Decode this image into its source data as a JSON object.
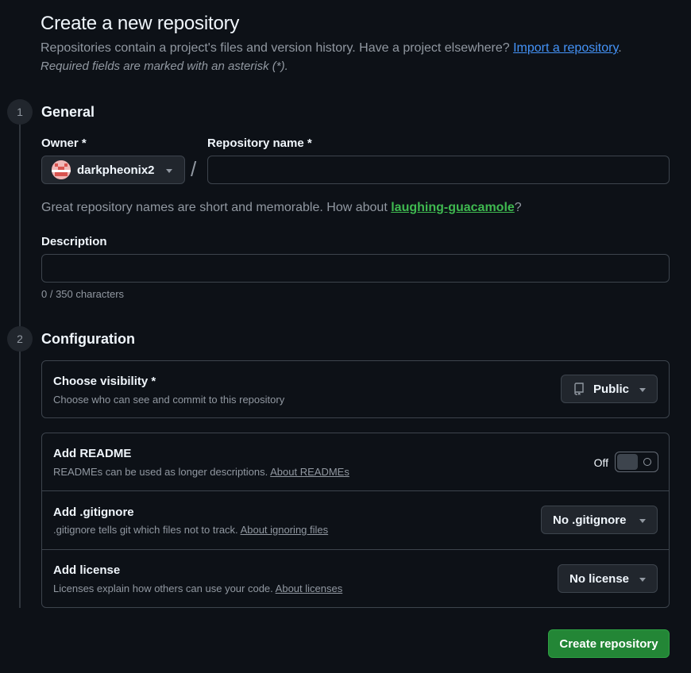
{
  "header": {
    "title": "Create a new repository",
    "subtitle_text": "Repositories contain a project's files and version history. Have a project elsewhere? ",
    "import_link": "Import a repository",
    "subtitle_end": ".",
    "required_note": "Required fields are marked with an asterisk (*)."
  },
  "general": {
    "step_number": "1",
    "title": "General",
    "owner_label": "Owner *",
    "owner_value": "darkpheonix2",
    "separator": "/",
    "repo_name_label": "Repository name *",
    "repo_name_value": "",
    "hint_prefix": "Great repository names are short and memorable. How about ",
    "hint_suggestion": "laughing-guacamole",
    "hint_suffix": "?",
    "description_label": "Description",
    "description_value": "",
    "char_count": "0 / 350 characters"
  },
  "configuration": {
    "step_number": "2",
    "title": "Configuration",
    "visibility": {
      "title": "Choose visibility *",
      "description": "Choose who can see and commit to this repository",
      "value": "Public",
      "icon": "repo-icon"
    },
    "readme": {
      "title": "Add README",
      "description": "READMEs can be used as longer descriptions. ",
      "link": "About READMEs",
      "toggle_state": "Off"
    },
    "gitignore": {
      "title": "Add .gitignore",
      "description": ".gitignore tells git which files not to track. ",
      "link": "About ignoring files",
      "value": "No .gitignore"
    },
    "license": {
      "title": "Add license",
      "description": "Licenses explain how others can use your code. ",
      "link": "About licenses",
      "value": "No license"
    }
  },
  "actions": {
    "create_label": "Create repository"
  },
  "colors": {
    "background": "#0d1117",
    "accent_link": "#4493f8",
    "suggestion": "#3fb950",
    "primary_button": "#238636",
    "border": "#3d444d"
  }
}
